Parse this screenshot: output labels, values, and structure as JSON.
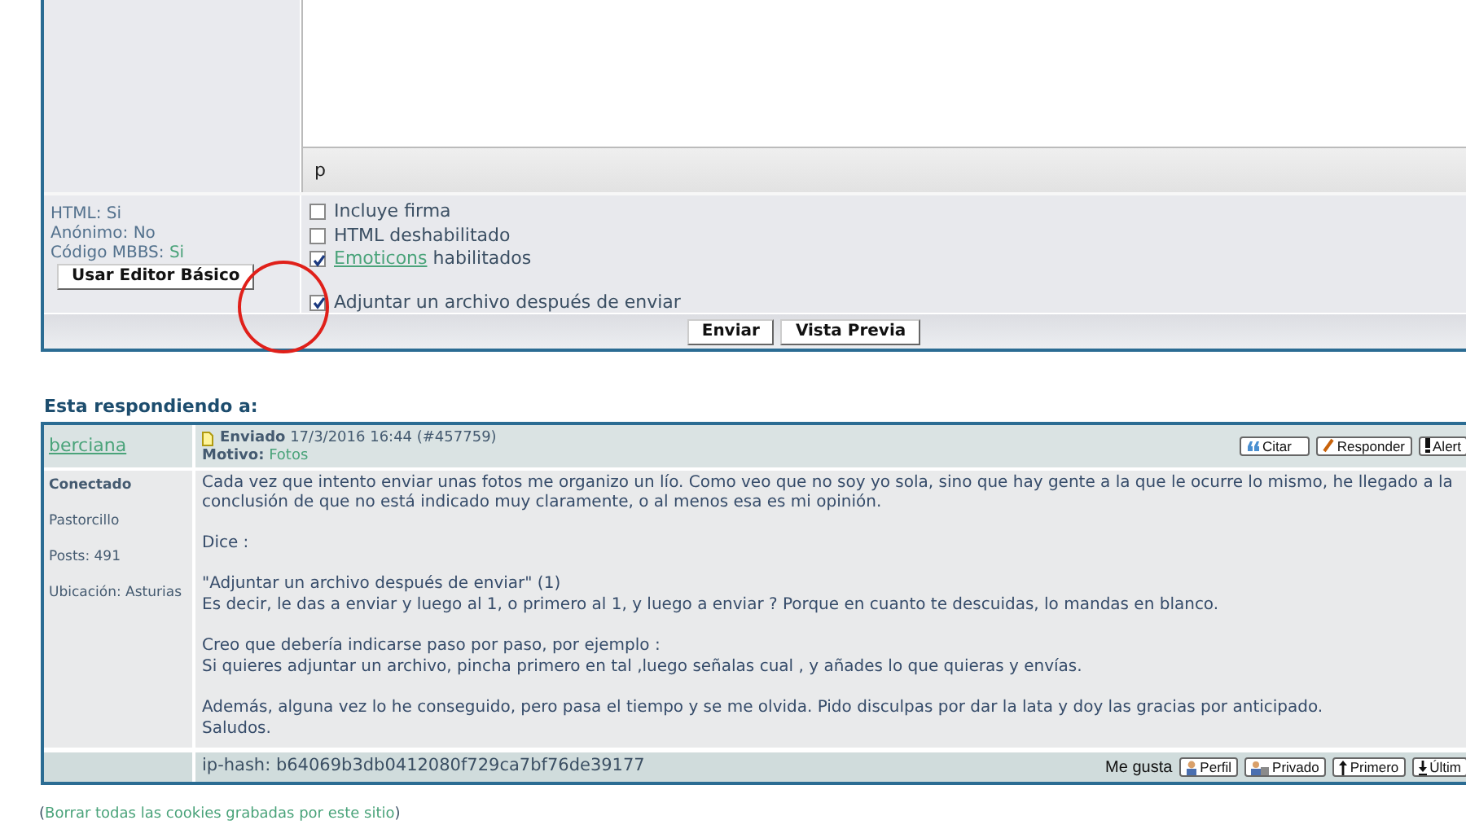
{
  "editor": {
    "path_indicator": "p"
  },
  "form_info": [
    {
      "label": "HTML:",
      "value": "Si",
      "link": false
    },
    {
      "label": "Anónimo:",
      "value": "No",
      "link": false
    },
    {
      "label": "Código MBBS:",
      "value": "Si",
      "link": true
    }
  ],
  "basic_editor_button": "Usar Editor Básico",
  "options": [
    {
      "label": "Incluye firma",
      "checked": false
    },
    {
      "label": "HTML deshabilitado",
      "checked": false
    },
    {
      "link": "Emoticons",
      "label": "habilitados",
      "checked": true
    },
    {
      "label": "Adjuntar un archivo después de enviar",
      "checked": true
    }
  ],
  "form_buttons": [
    "Enviar",
    "Vista Previa"
  ],
  "reply_heading": "Esta respondiendo a:",
  "post": {
    "author": "berciana",
    "sent_label": "Enviado",
    "sent_date": "17/3/2016 16:44 (#457759)",
    "reason_label": "Motivo:",
    "reason": "Fotos",
    "actions": [
      {
        "kind": "quote",
        "label": "Citar"
      },
      {
        "kind": "reply",
        "label": "Responder"
      },
      {
        "kind": "alert",
        "label": "Alert"
      }
    ],
    "status": "Conectado",
    "rank": "Pastorcillo",
    "posts": "Posts: 491",
    "location": "Ubicación: Asturias",
    "paragraphs": [
      [
        "Cada vez que intento enviar unas fotos me organizo un lío. Como veo que no soy yo sola, sino que hay gente a la que le ocurre lo mismo, he llegado a la",
        "conclusión de que no está indicado muy claramente, o al menos esa es mi opinión."
      ],
      [
        "Dice :"
      ],
      [
        "\"Adjuntar un archivo después de enviar\" (1)",
        "Es decir, le das a enviar y luego al 1, o primero al 1, y luego a enviar ? Porque en cuanto te descuidas, lo mandas en blanco."
      ],
      [
        "Creo que debería indicarse paso por paso, por ejemplo :",
        "Si quieres adjuntar un archivo, pincha primero en tal ,luego señalas cual , y añades lo que quieras y envías."
      ],
      [
        "Además, alguna vez lo he conseguido, pero pasa el tiempo y se me olvida. Pido disculpas por dar la lata y doy las gracias por anticipado.",
        "Saludos."
      ]
    ],
    "ip_hash": "ip-hash: b64069b3db0412080f729ca7bf76de39177",
    "like_label": "Me gusta",
    "footer_actions": [
      {
        "kind": "profile",
        "label": "Perfil"
      },
      {
        "kind": "private",
        "label": "Privado"
      },
      {
        "kind": "first",
        "label": "Primero"
      },
      {
        "kind": "last",
        "label": "Últim"
      }
    ]
  },
  "cookies_link": {
    "open": "(",
    "text": "Borrar todas las cookies grabadas por este sitio",
    "close": ")"
  }
}
